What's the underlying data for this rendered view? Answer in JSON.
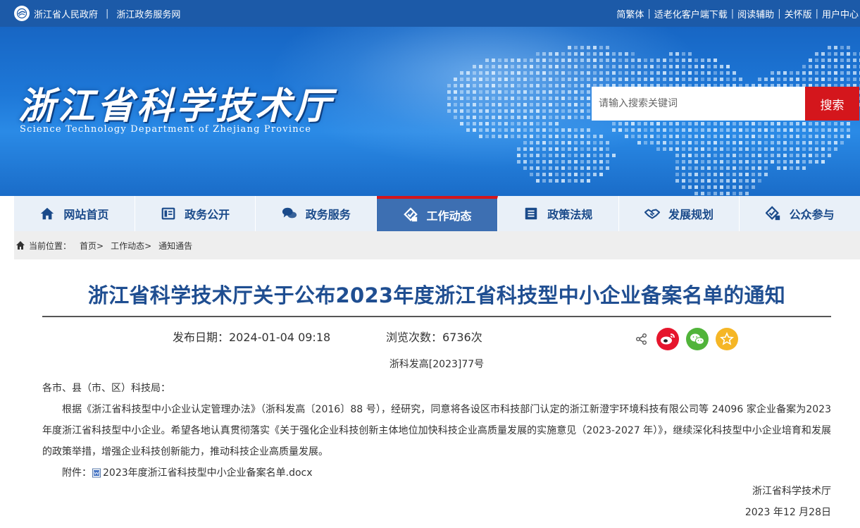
{
  "topbar": {
    "gov_link": "浙江省人民政府",
    "service_link": "浙江政务服务网",
    "divider": "|",
    "links": [
      "简繁体",
      "适老化客户端下载",
      "阅读辅助",
      "关怀版",
      "用户中心"
    ]
  },
  "banner": {
    "title_cn": "浙江省科学技术厅",
    "title_en": "Science Technology Department of Zhejiang Province",
    "search_placeholder": "请输入搜索关键词",
    "search_button": "搜索"
  },
  "nav": {
    "items": [
      {
        "label": "网站首页",
        "icon": "home-icon"
      },
      {
        "label": "政务公开",
        "icon": "document-icon"
      },
      {
        "label": "政务服务",
        "icon": "chat-icon"
      },
      {
        "label": "工作动态",
        "icon": "diamond-check-icon"
      },
      {
        "label": "政策法规",
        "icon": "list-icon"
      },
      {
        "label": "发展规划",
        "icon": "handshake-icon"
      },
      {
        "label": "公众参与",
        "icon": "participation-icon"
      }
    ],
    "active_index": 3
  },
  "breadcrumb": {
    "label": "当前位置：",
    "items": [
      "首页>",
      "工作动态>",
      "通知通告"
    ]
  },
  "article": {
    "title": "浙江省科学技术厅关于公布2023年度浙江省科技型中小企业备案名单的通知",
    "publish_date": "发布日期：2024-01-04 09:18",
    "views": "浏览次数：6736次",
    "doc_number": "浙科发高[2023]77号",
    "salutation": "各市、县（市、区）科技局：",
    "paragraph": "根据《浙江省科技型中小企业认定管理办法》（浙科发高〔2016〕88 号），经研究，同意将各设区市科技部门认定的浙江新澄宇环境科技有限公司等 24096 家企业备案为2023年度浙江省科技型中小企业。希望各地认真贯彻落实《关于强化企业科技创新主体地位加快科技企业高质量发展的实施意见（2023-2027 年）》，继续深化科技型中小企业培育和发展的政策举措，增强企业科技创新能力，推动科技企业高质量发展。",
    "attachment_label": "附件：",
    "attachment_file": "2023年度浙江省科技型中小企业备案名单.docx",
    "signer": "浙江省科学技术厅",
    "sign_date": "2023 年12 月28日"
  },
  "colors": {
    "topbar": "#1c5aa8",
    "nav_active": "#3d6fb2",
    "accent_red": "#d4161c",
    "title_blue": "#1f4e91",
    "weibo": "#e6162d",
    "wechat": "#51b43a",
    "favorite": "#f5b626"
  }
}
